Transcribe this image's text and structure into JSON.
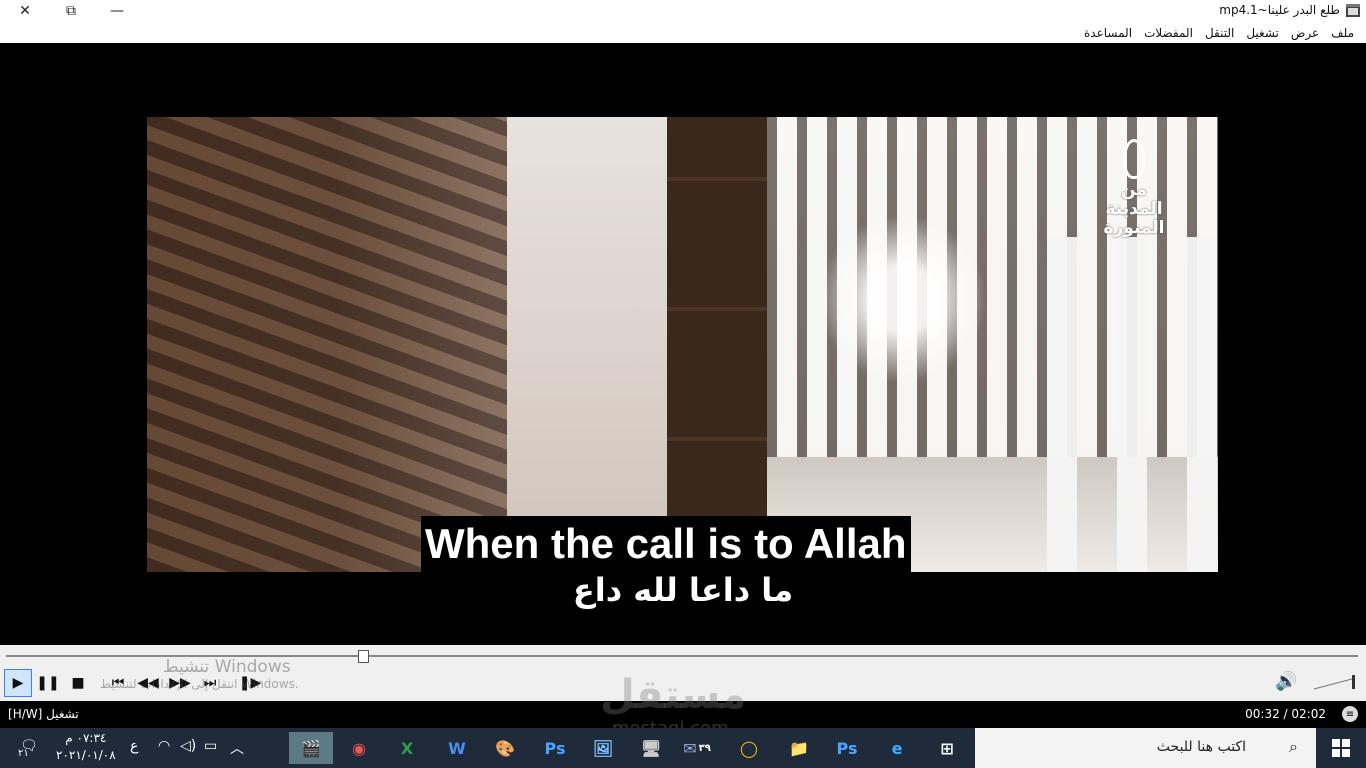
{
  "window": {
    "title": "طلع البدر علينا~mp4.1",
    "close_glyph": "✕",
    "maximize_glyph": "⧉",
    "minimize_glyph": "—"
  },
  "menu": [
    "ملف",
    "عرض",
    "تشغيل",
    "التنقل",
    "المفضلات",
    "المساعدة"
  ],
  "video": {
    "logo_text_1": "من",
    "logo_text_2": "المدينة",
    "logo_text_3": "المنورة",
    "subtitle_en": "When the call is to Allah",
    "subtitle_ar": "ما داعا لله داع"
  },
  "player": {
    "progress": 0.264,
    "controls": {
      "play": "▶",
      "pause": "❚❚",
      "stop": "■",
      "prev": "⏮",
      "rewind": "◀◀",
      "forward": "▶▶",
      "next": "⏭",
      "frame_step": "❚▶"
    },
    "activation_line1": "تنشيط Windows",
    "activation_line2": "انتقل إلى الإعدادات لتنشيط Windows.",
    "volume_glyph": "🔊",
    "status_left": "تشغيل [H/W]",
    "time": "00:32 / 02:02",
    "status_grip": "≡"
  },
  "taskbar": {
    "clock_time": "٠٧:٣٤ م",
    "clock_date": "٢٠٢١/٠١/٠٨",
    "notification_glyph": "🗨",
    "notification_count": "٢١",
    "lang": "ع",
    "apps": [
      "🎬",
      "◉",
      "X",
      "W",
      "🎨",
      "Ps",
      "🖼",
      "🖥",
      "✉",
      "◯",
      "📁",
      "Ps",
      "e",
      "⊞"
    ],
    "mail_count": "٣٩",
    "search_placeholder": "اكتب هنا للبحث",
    "search_glyph": "⌕"
  },
  "brand_watermark": "مستقل",
  "brand_watermark_url": "mostaql.com"
}
